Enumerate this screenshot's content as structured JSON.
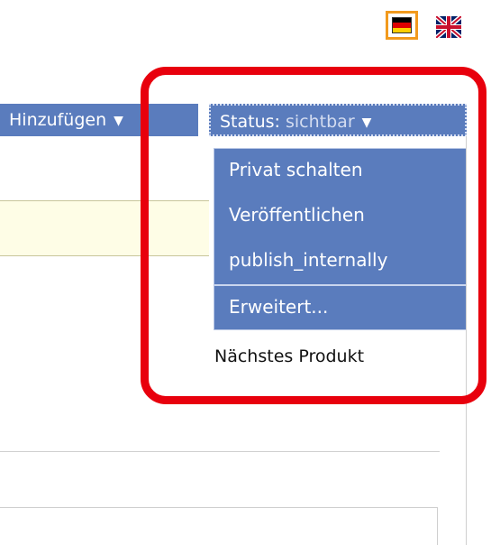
{
  "languages": {
    "german": "Deutsch",
    "english": "English"
  },
  "toolbar": {
    "add_label": "Hinzufügen",
    "status_label": "Status:",
    "status_value": "sichtbar"
  },
  "status_menu": {
    "items": [
      "Privat schalten",
      "Veröffentlichen",
      "publish_internally"
    ],
    "advanced": "Erweitert..."
  },
  "next_product": "Nächstes Produkt",
  "colors": {
    "menu_bg": "#5a7cbd",
    "highlight": "#e8000d",
    "active_flag_border": "#f29a1d"
  }
}
